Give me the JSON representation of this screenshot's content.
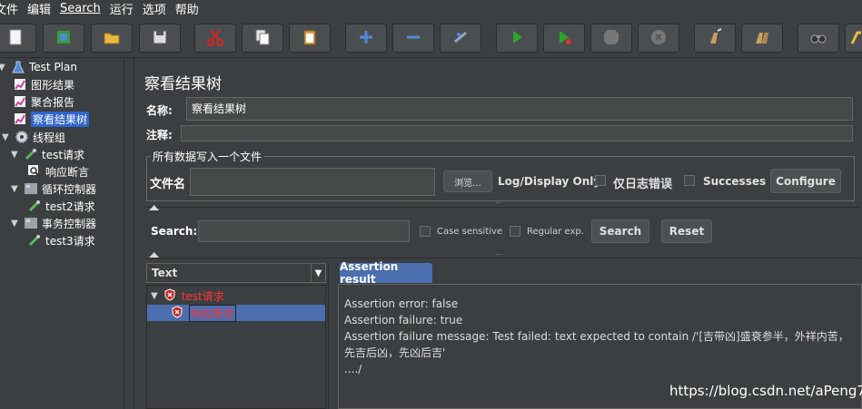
{
  "menu": [
    "文件",
    "编辑",
    "Search",
    "运行",
    "选项",
    "帮助"
  ],
  "toolbar_icons": [
    "new-icon",
    "templates-icon",
    "open-icon",
    "save-icon",
    "cut-icon",
    "copy-icon",
    "paste-icon",
    "expand-icon",
    "collapse-icon",
    "toggle-icon",
    "start-icon",
    "start-no-pause-icon",
    "stop-icon",
    "shutdown-icon",
    "clear-icon",
    "clear-all-icon",
    "search-icon",
    "reset-search-icon"
  ],
  "tree": {
    "items": [
      {
        "label": "Test Plan",
        "icon": "flask-icon",
        "toggle": "▼"
      },
      {
        "label": "图形结果",
        "icon": "graph-icon",
        "toggle": ""
      },
      {
        "label": "聚合报告",
        "icon": "graph-icon",
        "toggle": ""
      },
      {
        "label": "察看结果树",
        "icon": "graph-icon",
        "toggle": "",
        "selected": true
      },
      {
        "label": "线程组",
        "icon": "gear-icon",
        "toggle": "▼"
      },
      {
        "label": "test请求",
        "icon": "pipette-icon",
        "toggle": "▼"
      },
      {
        "label": "响应断言",
        "icon": "magnifier-icon",
        "toggle": ""
      },
      {
        "label": "循环控制器",
        "icon": "controller-icon",
        "toggle": "▼"
      },
      {
        "label": "test2请求",
        "icon": "pipette-icon",
        "toggle": ""
      },
      {
        "label": "事务控制器",
        "icon": "controller-icon",
        "toggle": "▼"
      },
      {
        "label": "test3请求",
        "icon": "pipette-icon",
        "toggle": ""
      }
    ]
  },
  "panel": {
    "title": "察看结果树",
    "name_label": "名称:",
    "name_value": "察看结果树",
    "comment_label": "注释:",
    "comment_value": "",
    "file_group_title": "所有数据写入一个文件",
    "filename_label": "文件名",
    "filename_value": "",
    "browse_label": "浏览...",
    "log_display_label": "Log/Display Only:",
    "errors_only_label": "仅日志错误",
    "successes_label": "Successes",
    "configure_label": "Configure"
  },
  "search": {
    "label": "Search:",
    "value": "",
    "case_sensitive_label": "Case sensitive",
    "regexp_label": "Regular exp.",
    "search_button": "Search",
    "reset_button": "Reset"
  },
  "results": {
    "renderer": "Text",
    "items": [
      {
        "label": "test请求",
        "status": "error"
      },
      {
        "label": "响应断言",
        "status": "error",
        "selected": true
      }
    ]
  },
  "assertion": {
    "tab_label": "Assertion result",
    "lines": [
      "Assertion error: false",
      "Assertion failure: true",
      "Assertion failure message: Test failed: text expected to contain /'[吉带凶]盛衰参半，外祥内苦，先吉后凶，先凶后吉'",
      "..../"
    ]
  },
  "watermark": "https://blog.csdn.net/aPeng7"
}
